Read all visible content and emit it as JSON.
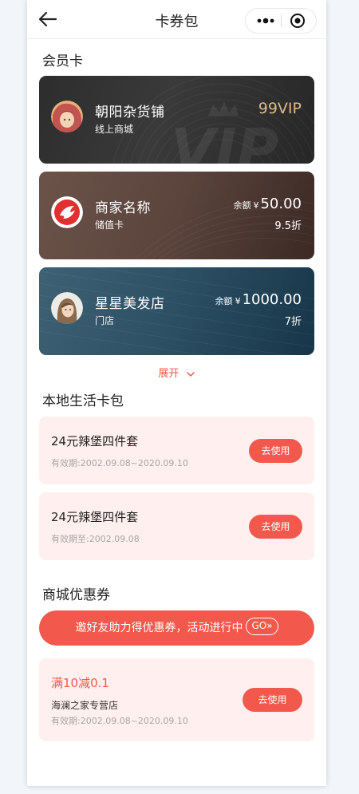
{
  "header": {
    "title": "卡券包",
    "more_icon": "more-dots-icon",
    "target_icon": "target-circle-icon",
    "back_icon": "back-arrow-icon"
  },
  "sections": {
    "member_cards": "会员卡",
    "local_life": "本地生活卡包",
    "mall_coupons": "商城优惠券"
  },
  "member_cards": [
    {
      "name": "朝阳杂货铺",
      "sub": "线上商城",
      "badge": "99VIP",
      "watermark": "VIP"
    },
    {
      "name": "商家名称",
      "sub": "储值卡",
      "balance_label": "余额",
      "currency": "¥",
      "amount": "50.00",
      "discount": "9.5折"
    },
    {
      "name": "星星美发店",
      "sub": "门店",
      "balance_label": "余额",
      "currency": "¥",
      "amount": "1000.00",
      "discount": "7折"
    }
  ],
  "expand": {
    "label": "展开",
    "icon": "chevron-down-icon"
  },
  "local_coupons": [
    {
      "title": "24元辣堡四件套",
      "valid": "有效期:2002.09.08~2020.09.10",
      "button": "去使用"
    },
    {
      "title": "24元辣堡四件套",
      "valid": "有效期至:2002.09.08",
      "button": "去使用"
    }
  ],
  "invite_banner": {
    "text": "邀好友助力得优惠券，活动进行中",
    "go": "GO»"
  },
  "mall_coupon": {
    "title": "满10减0.1",
    "shop": "海澜之家专营店",
    "valid": "有效期:2002.09.08~2020.09.10",
    "button": "去使用"
  },
  "colors": {
    "accent": "#f3584d",
    "vip_gold": "#d9b98a",
    "coupon_bg": "#fff0ef"
  }
}
